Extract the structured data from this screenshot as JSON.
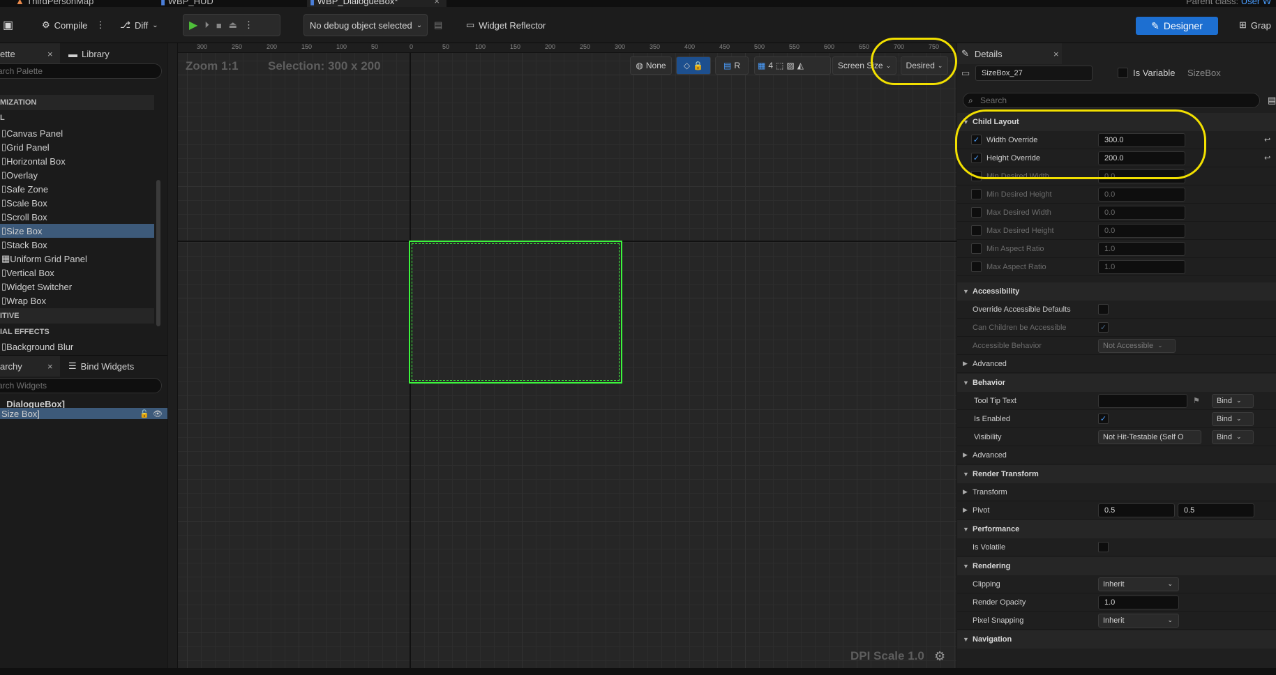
{
  "doc_tabs": [
    "ThirdPersonMap",
    "WBP_HUD",
    "WBP_DialogueBox*"
  ],
  "parent_class_label": "Parent class:",
  "parent_class_value": "User W",
  "toolbar": {
    "compile": "Compile",
    "diff": "Diff",
    "debug_object": "No debug object selected",
    "widget_reflector": "Widget Reflector",
    "designer": "Designer",
    "graph": "Grap"
  },
  "palette": {
    "tab_label": "ette",
    "library_tab": "Library",
    "search_placeholder": "arch Palette",
    "categories": [
      "MIZATION",
      "L",
      "ITIVE",
      "IAL EFFECTS"
    ],
    "items": [
      "Canvas Panel",
      "Grid Panel",
      "Horizontal Box",
      "Overlay",
      "Safe Zone",
      "Scale Box",
      "Scroll Box",
      "Size Box",
      "Stack Box",
      "Uniform Grid Panel",
      "Vertical Box",
      "Widget Switcher",
      "Wrap Box"
    ],
    "effects_items": [
      "Background Blur"
    ]
  },
  "hierarchy": {
    "tab_label": "archy",
    "bind_widgets_tab": "Bind Widgets",
    "search_placeholder": "arch Widgets",
    "root": "_DialogueBox]",
    "child": "Size Box]"
  },
  "viewport": {
    "zoom": "Zoom 1:1",
    "selection": "Selection: 300 x 200",
    "dpi_scale": "DPI Scale 1.0",
    "none_label": "None",
    "r_label": "R",
    "grid_snap": "4",
    "screen_size": "Screen Size",
    "desired": "Desired",
    "ruler_h_labels": [
      "300",
      "250",
      "200",
      "150",
      "100",
      "50",
      "0",
      "50",
      "100",
      "150",
      "200",
      "250",
      "300",
      "350",
      "400",
      "450",
      "500",
      "550",
      "600",
      "650",
      "700",
      "750"
    ]
  },
  "details": {
    "tab_label": "Details",
    "widget_name": "SizeBox_27",
    "is_variable": "Is Variable",
    "widget_class": "SizeBox",
    "search_placeholder": "Search",
    "sections": {
      "child_layout": "Child Layout",
      "accessibility": "Accessibility",
      "advanced": "Advanced",
      "behavior": "Behavior",
      "render_transform": "Render Transform",
      "performance": "Performance",
      "rendering": "Rendering",
      "navigation": "Navigation"
    },
    "child_layout_props": [
      {
        "label": "Width Override",
        "value": "300.0",
        "checked": true
      },
      {
        "label": "Height Override",
        "value": "200.0",
        "checked": true
      },
      {
        "label": "Min Desired Width",
        "value": "0.0",
        "checked": false
      },
      {
        "label": "Min Desired Height",
        "value": "0.0",
        "checked": false
      },
      {
        "label": "Max Desired Width",
        "value": "0.0",
        "checked": false
      },
      {
        "label": "Max Desired Height",
        "value": "0.0",
        "checked": false
      },
      {
        "label": "Min Aspect Ratio",
        "value": "1.0",
        "checked": false
      },
      {
        "label": "Max Aspect Ratio",
        "value": "1.0",
        "checked": false
      }
    ],
    "accessibility_props": {
      "override": "Override Accessible Defaults",
      "children": "Can Children be Accessible",
      "behavior": "Accessible Behavior",
      "behavior_value": "Not Accessible"
    },
    "behavior_props": {
      "tooltip": "Tool Tip Text",
      "enabled": "Is Enabled",
      "visibility": "Visibility",
      "visibility_value": "Not Hit-Testable (Self O",
      "bind": "Bind"
    },
    "render_transform_props": {
      "transform": "Transform",
      "pivot": "Pivot",
      "pivot_x": "0.5",
      "pivot_y": "0.5"
    },
    "performance_props": {
      "volatile": "Is Volatile"
    },
    "rendering_props": {
      "clipping": "Clipping",
      "clipping_value": "Inherit",
      "opacity": "Render Opacity",
      "opacity_value": "1.0",
      "snapping": "Pixel Snapping",
      "snapping_value": "Inherit"
    }
  },
  "colors": {
    "accent": "#1d6fd1",
    "selection_outline": "#3cf53c",
    "annotation": "#f2e000"
  }
}
